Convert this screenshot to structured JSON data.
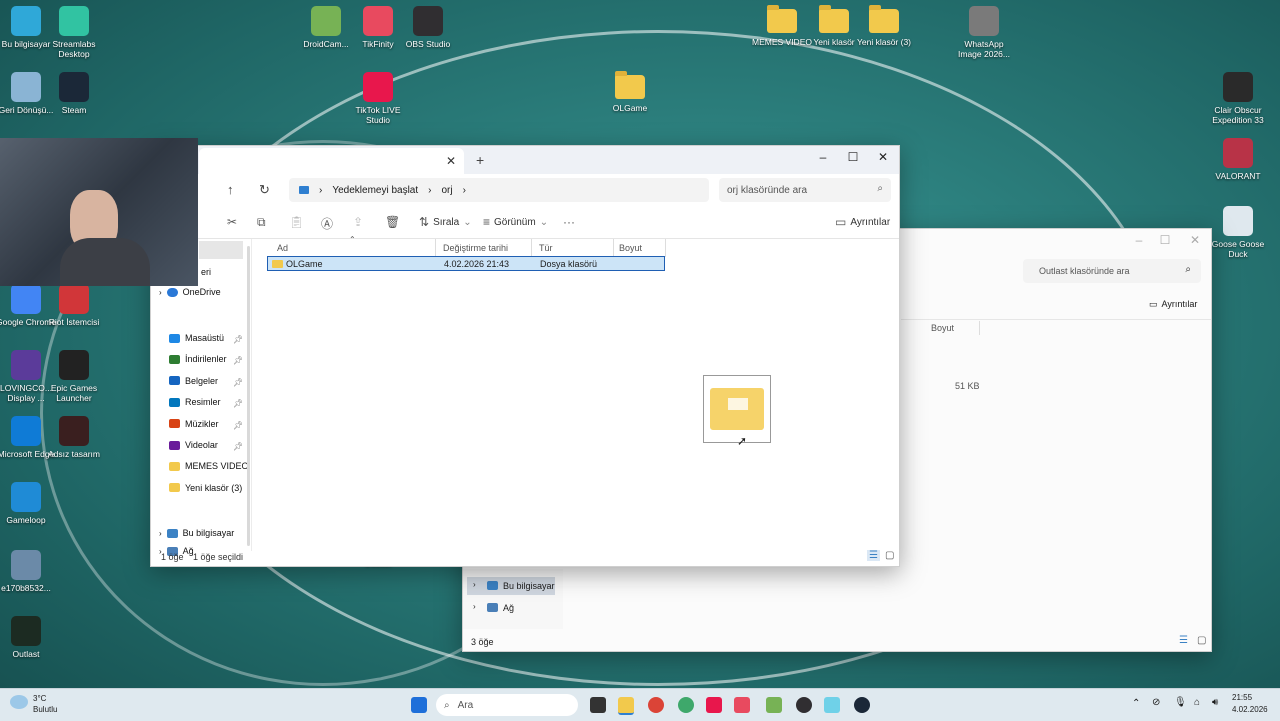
{
  "desktop": {
    "icons": [
      {
        "label": "Bu bilgisayar",
        "color": "#2fa8d8"
      },
      {
        "label": "Streamlabs Desktop",
        "color": "#31c3a2"
      },
      {
        "label": "Geri Dönüşü...",
        "color": "#8ab4d4"
      },
      {
        "label": "Steam",
        "color": "#1b2838"
      },
      {
        "label": "DroidCam...",
        "color": "#77b255"
      },
      {
        "label": "TikFinity",
        "color": "#e84a5f"
      },
      {
        "label": "OBS Studio",
        "color": "#302e31"
      },
      {
        "label": "TikTok LIVE Studio",
        "color": "#e8174c"
      },
      {
        "label": "OLGame",
        "color": "#f2c94c"
      },
      {
        "label": "MEMES VIDEO",
        "color": "#f2c94c"
      },
      {
        "label": "Yeni klasör",
        "color": "#f2c94c"
      },
      {
        "label": "Yeni klasör (3)",
        "color": "#f2c94c"
      },
      {
        "label": "WhatsApp Image 2026...",
        "color": "#7a7a7a"
      },
      {
        "label": "Clair Obscur Expedition 33",
        "color": "#2a2a2a"
      },
      {
        "label": "VALORANT",
        "color": "#b83347"
      },
      {
        "label": "Goose Goose Duck",
        "color": "#dfe8ee"
      },
      {
        "label": "Google Chrome",
        "color": "#4285f4"
      },
      {
        "label": "Riot İstemcisi",
        "color": "#d13639"
      },
      {
        "label": "LOVINGCO... Display ...",
        "color": "#5b3b9a"
      },
      {
        "label": "Epic Games Launcher",
        "color": "#222222"
      },
      {
        "label": "Microsoft Edge",
        "color": "#0f7bd6"
      },
      {
        "label": "Adsız tasarım",
        "color": "#3a1f1f"
      },
      {
        "label": "Gameloop",
        "color": "#1f8bd6"
      },
      {
        "label": "e170b8532...",
        "color": "#6b8aa8"
      },
      {
        "label": "Outlast",
        "color": "#1c2b22"
      },
      {
        "label": "Outlast",
        "color": "transparent"
      }
    ]
  },
  "bg_window": {
    "search_placeholder": "Outlast klasöründe ara",
    "details_label": "Ayrıntılar",
    "col_size": "Boyut",
    "size_value": "51 KB",
    "side_items": [
      "Bu bilgisayar",
      "Ağ"
    ],
    "status": "3 öğe"
  },
  "main_window": {
    "breadcrumb": [
      "Yedeklemeyi başlat",
      "orj"
    ],
    "search_placeholder": "orj klasöründe ara",
    "toolbar": {
      "sort": "Sırala",
      "view": "Görünüm",
      "details": "Ayrıntılar"
    },
    "columns": {
      "name": "Ad",
      "modified": "Değiştirme tarihi",
      "type": "Tür",
      "size": "Boyut"
    },
    "rows": [
      {
        "name": "OLGame",
        "modified": "4.02.2026 21:43",
        "type": "Dosya klasörü",
        "size": ""
      }
    ],
    "sidebar": {
      "partial": "eri",
      "onedrive": "OneDrive",
      "quick": [
        "Masaüstü",
        "İndirilenler",
        "Belgeler",
        "Resimler",
        "Müzikler",
        "Videolar",
        "MEMES VIDEO",
        "Yeni klasör (3)"
      ],
      "pc": "Bu bilgisayar",
      "network": "Ağ"
    },
    "status": {
      "count": "1 öğe",
      "selected": "1 öğe seçildi"
    }
  },
  "taskbar": {
    "weather_temp": "3°C",
    "weather_desc": "Bulutlu",
    "search_placeholder": "Ara",
    "time": "21:55",
    "date": "4.02.2026"
  }
}
